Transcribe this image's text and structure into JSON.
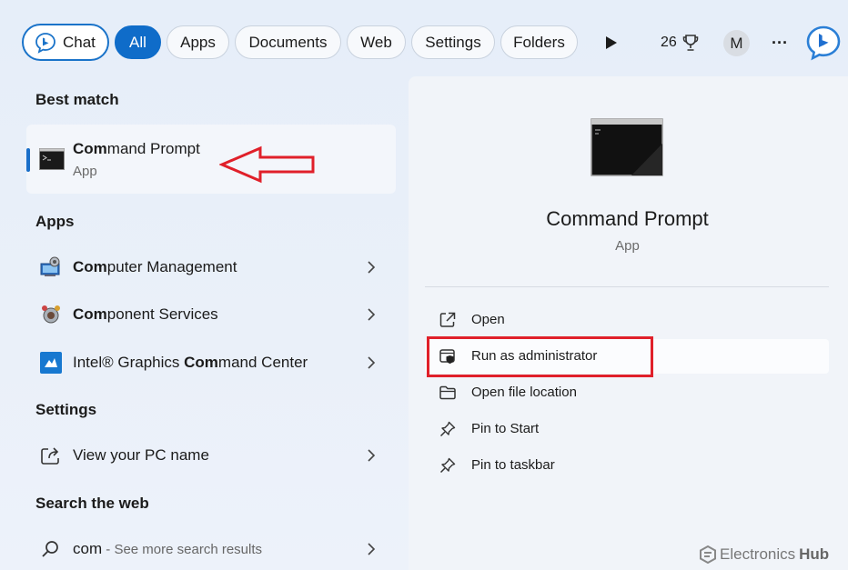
{
  "topbar": {
    "filters": [
      {
        "label": "Chat",
        "active": false
      },
      {
        "label": "All",
        "active": true
      },
      {
        "label": "Apps",
        "active": false
      },
      {
        "label": "Documents",
        "active": false
      },
      {
        "label": "Web",
        "active": false
      },
      {
        "label": "Settings",
        "active": false
      },
      {
        "label": "Folders",
        "active": false
      }
    ],
    "rewards_count": "26",
    "avatar_initial": "M",
    "more_label": "···"
  },
  "left": {
    "best_match_heading": "Best match",
    "best_match": {
      "title_bold": "Com",
      "title_rest": "mand Prompt",
      "subtitle": "App"
    },
    "apps_heading": "Apps",
    "apps": [
      {
        "bold": "Com",
        "rest": "puter Management",
        "prefix": "",
        "icon": "computer-management-icon"
      },
      {
        "bold": "Com",
        "rest": "ponent Services",
        "prefix": "",
        "icon": "component-services-icon"
      },
      {
        "prefix": "Intel® Graphics ",
        "bold": "Com",
        "rest": "mand Center",
        "icon": "intel-graphics-icon"
      }
    ],
    "settings_heading": "Settings",
    "settings": [
      {
        "label": "View your PC name",
        "icon": "share-screen-icon"
      }
    ],
    "web_heading": "Search the web",
    "web": [
      {
        "query": "com",
        "suffix": " - See more search results",
        "icon": "search-icon"
      }
    ]
  },
  "right": {
    "title": "Command Prompt",
    "subtitle": "App",
    "actions": [
      {
        "label": "Open",
        "icon": "open-external-icon"
      },
      {
        "label": "Run as administrator",
        "icon": "shield-admin-icon"
      },
      {
        "label": "Open file location",
        "icon": "folder-icon"
      },
      {
        "label": "Pin to Start",
        "icon": "pin-icon"
      },
      {
        "label": "Pin to taskbar",
        "icon": "pin-icon"
      }
    ]
  },
  "watermark": {
    "brand_light": "Electronics",
    "brand_bold": "Hub"
  },
  "colors": {
    "accent": "#0f6cc9",
    "highlight_box": "#e0202a"
  }
}
